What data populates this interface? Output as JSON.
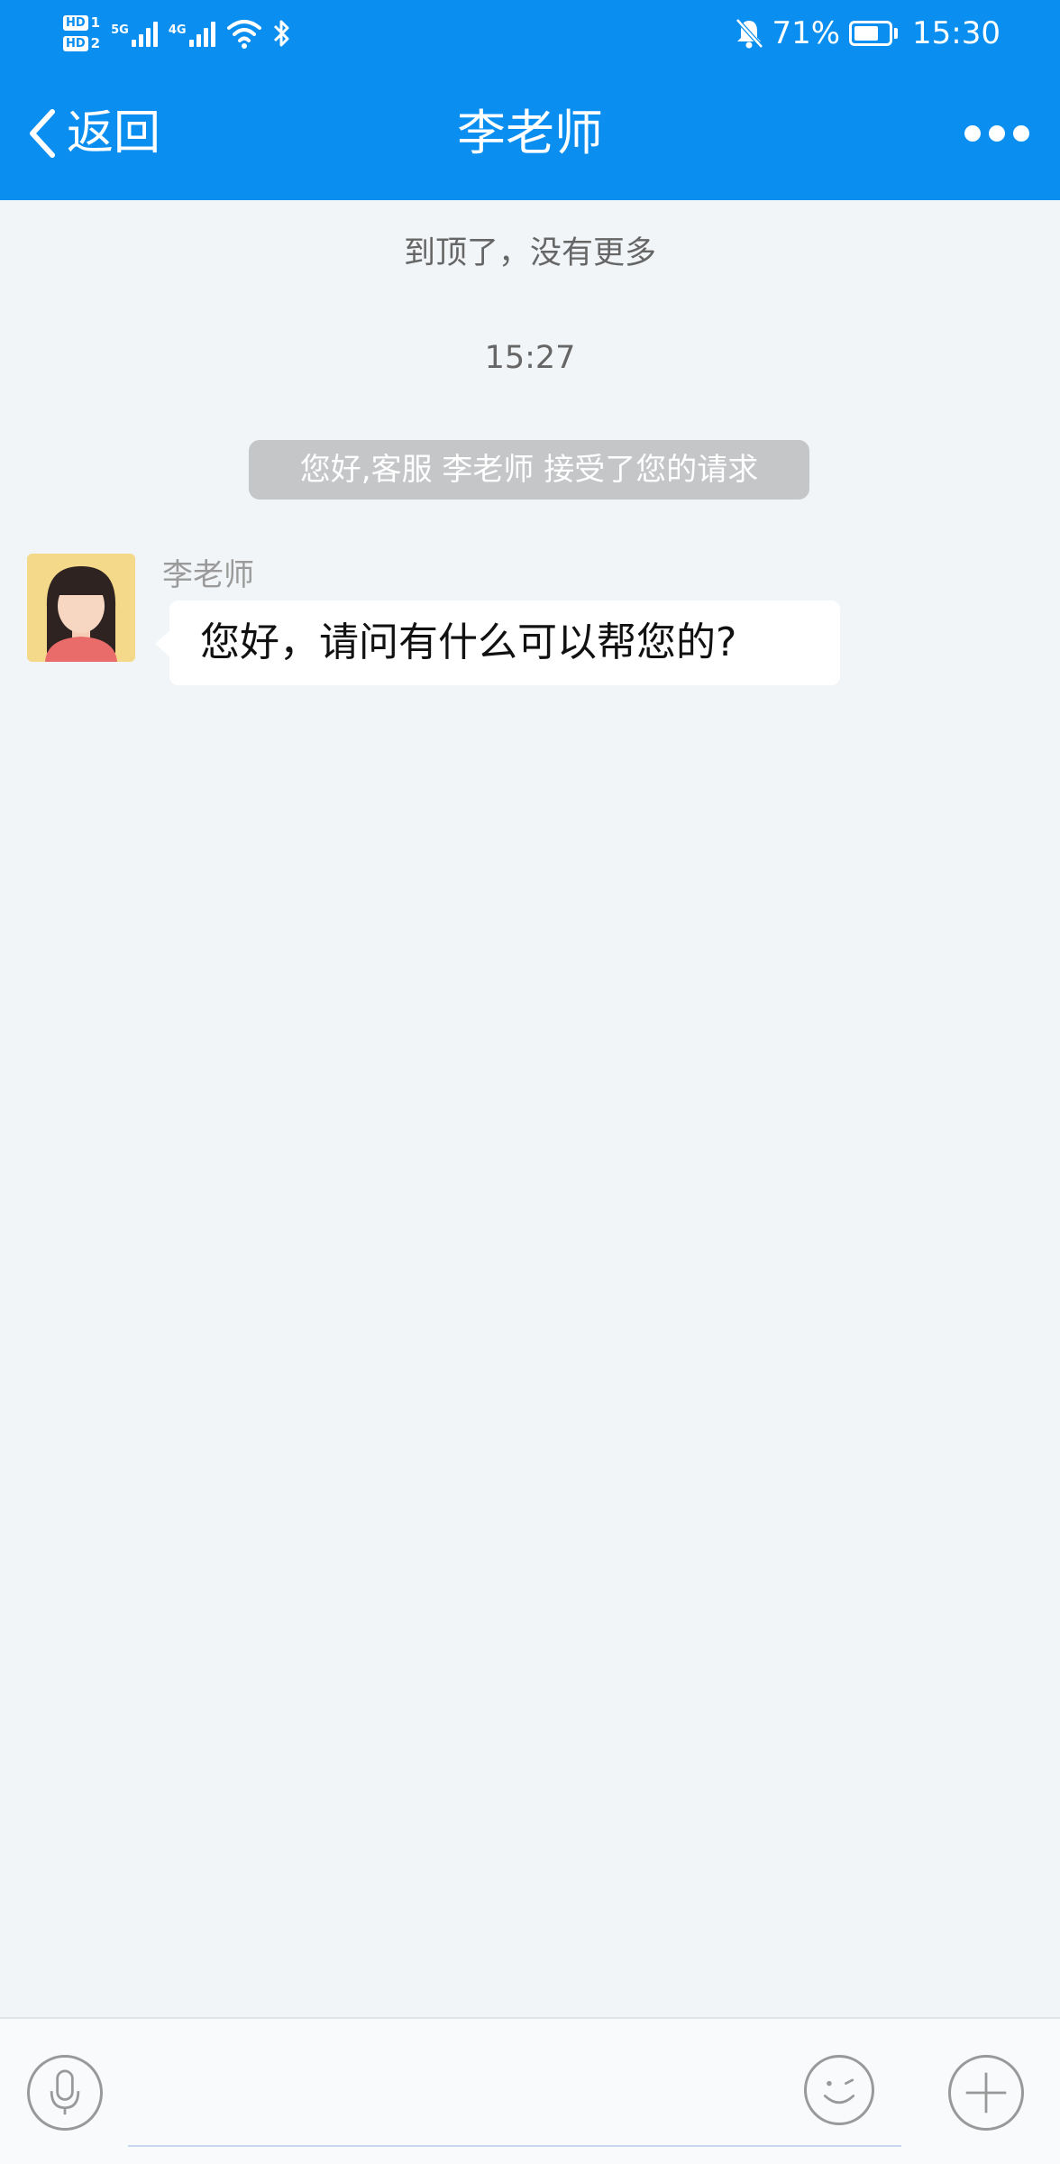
{
  "status_bar": {
    "hd1": "HD",
    "hd1_slot": "1",
    "hd2": "HD",
    "hd2_slot": "2",
    "net1": "5G",
    "net2": "4G",
    "battery_percent": "71%",
    "battery_level": 0.71,
    "time": "15:30",
    "icons": [
      "signal-icon",
      "wifi-icon",
      "bluetooth-icon",
      "bell-muted-icon",
      "battery-icon"
    ]
  },
  "nav": {
    "back_label": "返回",
    "title": "李老师",
    "more_icon": "more-icon"
  },
  "chat": {
    "top_hint": "到顶了，没有更多",
    "time_divider": "15:27",
    "system_message": "您好,客服 李老师 接受了您的请求",
    "messages": [
      {
        "sender": "李老师",
        "text": "您好，请问有什么可以帮您的?"
      }
    ]
  },
  "input_bar": {
    "voice_icon": "microphone-icon",
    "emoji_icon": "emoji-icon",
    "plus_icon": "plus-icon",
    "placeholder": ""
  },
  "colors": {
    "header": "#0a8ef0",
    "chat_background": "#f2f5f7",
    "system_bubble": "#c4c6c8",
    "incoming_bubble": "#ffffff"
  }
}
